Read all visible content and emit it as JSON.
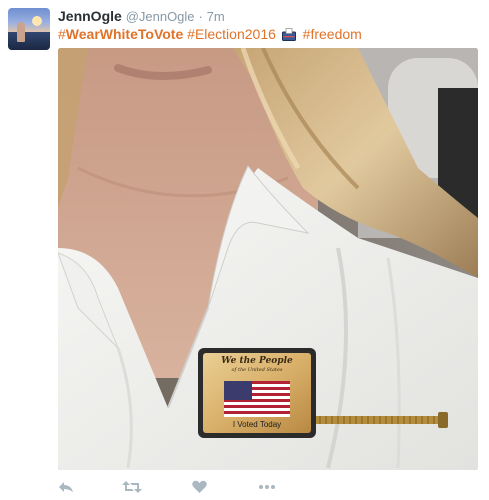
{
  "tweet": {
    "author_name": "JennOgle",
    "author_handle": "@JennOgle",
    "separator": "·",
    "time": "7m",
    "hashtags": [
      {
        "prefix": "#",
        "tag": "WearWhiteToVote"
      },
      {
        "prefix": "#",
        "tag": "Election2016"
      },
      {
        "prefix": "#",
        "tag": "freedom"
      }
    ],
    "emoji": "ballot-box-icon"
  },
  "sticker": {
    "header": "We the People",
    "subheader": "of the United States",
    "footer": "I Voted Today"
  },
  "colors": {
    "hashtag": "#e0732a",
    "muted": "#8899a6",
    "action_icon": "#aab8c2"
  },
  "actions": [
    {
      "name": "reply",
      "icon": "reply-icon"
    },
    {
      "name": "retweet",
      "icon": "retweet-icon"
    },
    {
      "name": "like",
      "icon": "heart-icon"
    },
    {
      "name": "more",
      "icon": "more-dots-icon"
    }
  ]
}
